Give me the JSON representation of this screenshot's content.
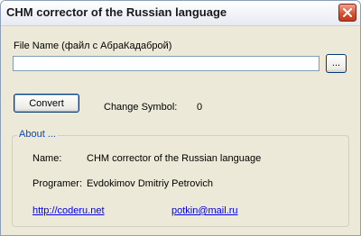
{
  "window": {
    "title": "CHM corrector of the Russian language"
  },
  "form": {
    "file_label": "File Name (файл с АбраКадаброй)",
    "file_value": "",
    "browse_label": "...",
    "convert_label": "Convert",
    "change_symbol_label": "Change Symbol:",
    "change_symbol_value": "0"
  },
  "about": {
    "title": "About ...",
    "name_label": "Name:",
    "name_value": "CHM corrector of the Russian language",
    "programmer_label": "Programer:",
    "programmer_value": "Evdokimov Dmitriy Petrovich",
    "site_link": "http://coderu.net",
    "email_link": "potkin@mail.ru"
  }
}
